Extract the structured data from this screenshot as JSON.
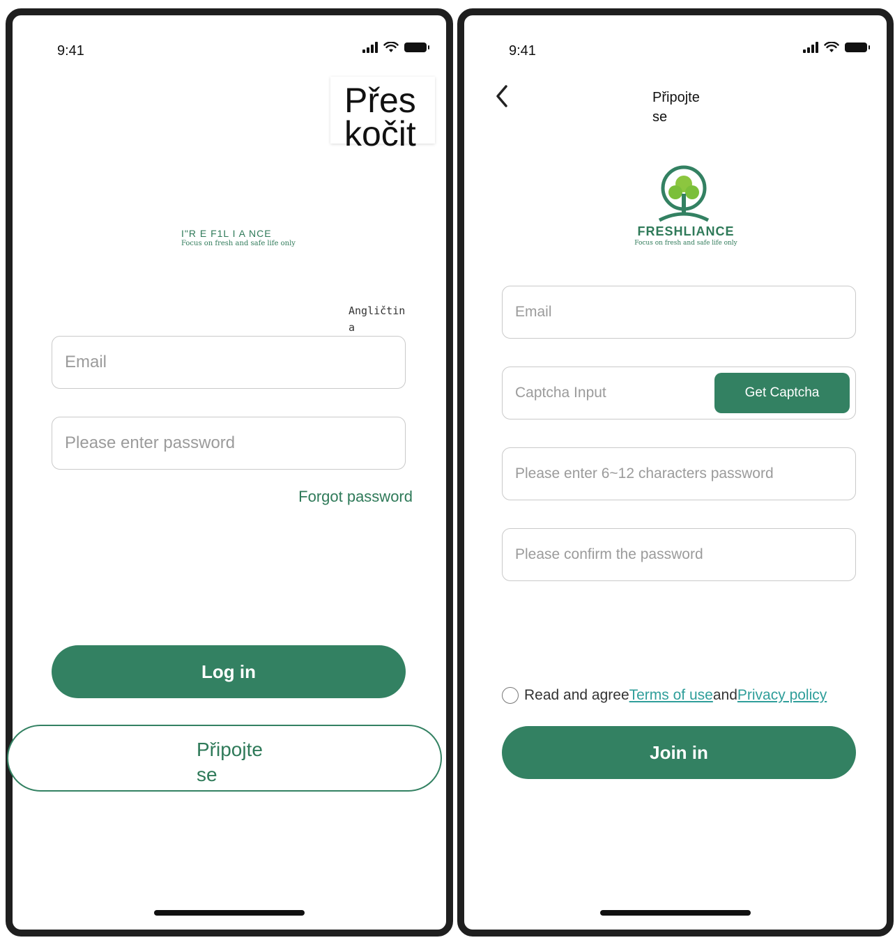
{
  "left_screen": {
    "status_time": "9:41",
    "skip_label": "Přes kočit",
    "brand_name": "I\"R E    F1L I A NCE",
    "brand_tagline": "Focus on fresh and safe life only",
    "language_label": "Angličtin a",
    "email_placeholder": "Email",
    "password_placeholder": "Please enter password",
    "forgot_password": "Forgot password",
    "login_label": "Log in",
    "join_label": "Připojte se"
  },
  "right_screen": {
    "status_time": "9:41",
    "title": "Připojte se",
    "brand_name": "FRESHLIANCE",
    "brand_tagline": "Focus on fresh and safe life only",
    "email_placeholder": "Email",
    "captcha_placeholder": "Captcha Input",
    "get_captcha_label": "Get Captcha",
    "password_placeholder": "Please enter 6~12 characters password",
    "confirm_placeholder": "Please confirm the password",
    "agree_prefix": "Read and agree",
    "terms_link": "Terms of use",
    "and_text": "and",
    "privacy_link": "Privacy policy",
    "join_label": "Join in"
  },
  "colors": {
    "brand_green": "#338162",
    "link_teal": "#2f9e9a"
  },
  "icons": [
    "signal-icon",
    "wifi-icon",
    "battery-icon",
    "back-chevron-icon",
    "tree-logo-icon",
    "radio-icon"
  ]
}
